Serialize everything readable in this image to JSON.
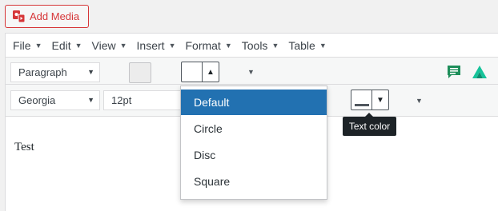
{
  "add_media": {
    "label": "Add Media",
    "icon": "media-upload-icon",
    "color": "#d63638"
  },
  "menubar": {
    "items": [
      {
        "label": "File",
        "name": "menu-file"
      },
      {
        "label": "Edit",
        "name": "menu-edit"
      },
      {
        "label": "View",
        "name": "menu-view"
      },
      {
        "label": "Insert",
        "name": "menu-insert"
      },
      {
        "label": "Format",
        "name": "menu-format"
      },
      {
        "label": "Tools",
        "name": "menu-tools"
      },
      {
        "label": "Table",
        "name": "menu-table"
      }
    ]
  },
  "toolbar1": {
    "block_format": "Paragraph",
    "background_swatch": "#ececec",
    "right_icons": [
      "comment-icon",
      "grammarly-icon"
    ]
  },
  "toolbar2": {
    "font_family": "Georgia",
    "font_size": "12pt",
    "text_color_bar": "#50575e"
  },
  "list_style_dropdown": {
    "options": [
      "Default",
      "Circle",
      "Disc",
      "Square"
    ],
    "selected": "Default",
    "highlight_color": "#2271b1"
  },
  "tooltip": {
    "text": "Text color"
  },
  "content": {
    "text": "Test"
  }
}
